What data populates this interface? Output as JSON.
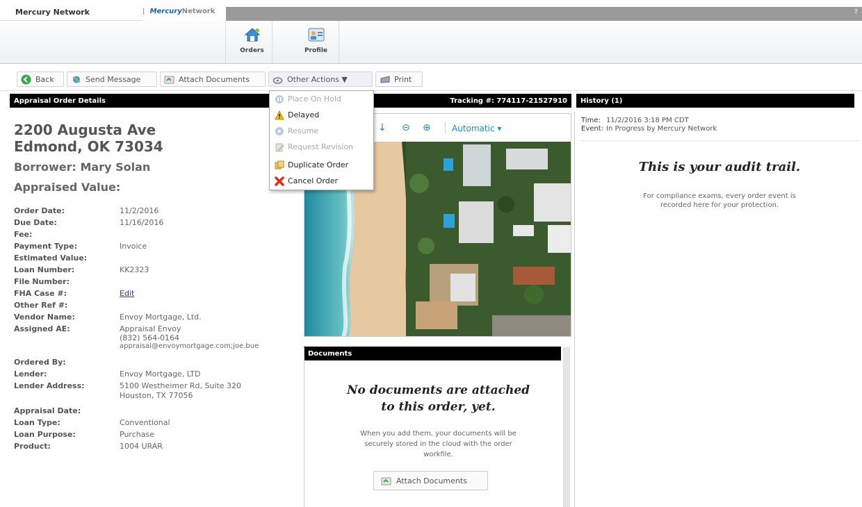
{
  "topbar": {
    "brand": "Mercury Network",
    "tab_sep": "|",
    "tab_mercury": "Mercury",
    "tab_network": "Network"
  },
  "ribbon": {
    "orders_label": "Orders",
    "profile_label": "Profile"
  },
  "toolbar": {
    "back": "Back",
    "send_message": "Send Message",
    "attach_documents": "Attach Documents",
    "other_actions": "Other Actions ▼",
    "print": "Print"
  },
  "left_header": "Appraisal Order Details",
  "tracking_header": "Tracking #: 774117-21527910",
  "history_header": "History (1)",
  "documents_header": "Documents",
  "order": {
    "address_line1": "2200 Augusta Ave",
    "address_line2": "Edmond, OK 73034",
    "borrower": "Borrower: Mary Solan",
    "appraised_value": "Appraised Value:"
  },
  "details": [
    {
      "label": "Order Date:",
      "value": "11/2/2016"
    },
    {
      "label": "Due Date:",
      "value": "11/16/2016"
    },
    {
      "label": "Fee:",
      "value": ""
    },
    {
      "label": "Payment Type:",
      "value": "Invoice"
    },
    {
      "label": "Estimated Value:",
      "value": ""
    },
    {
      "label": "Loan Number:",
      "value": "KK2323"
    },
    {
      "label": "File Number:",
      "value": ""
    },
    {
      "label": "FHA Case #:",
      "value": "Edit"
    },
    {
      "label": "Other Ref #:",
      "value": ""
    },
    {
      "label": "Vendor Name:",
      "value": "Envoy Mortgage, Ltd."
    },
    {
      "label": "Assigned AE:",
      "value": "Appraisal Envoy"
    },
    {
      "label": "",
      "value": "(832) 564-0164"
    },
    {
      "label": "",
      "value": "appraisal@envoymortgage.com;joe.bue"
    },
    {
      "label": "Ordered By:",
      "value": ""
    },
    {
      "label": "Lender:",
      "value": "Envoy Mortgage, LTD"
    },
    {
      "label": "Lender Address:",
      "value": "5100 Westheimer Rd, Suite 320"
    },
    {
      "label": "",
      "value": "Houston, TX 77056"
    },
    {
      "label": "Appraisal Date:",
      "value": ""
    },
    {
      "label": "Loan Type:",
      "value": "Conventional"
    },
    {
      "label": "Loan Purpose:",
      "value": "Purchase"
    },
    {
      "label": "Product:",
      "value": "1004 URAR"
    }
  ],
  "map": {
    "mode": "Automatic ▾"
  },
  "documents": {
    "empty_title_1": "No documents are attached",
    "empty_title_2": "to this order, yet.",
    "empty_text_1": "When you add them, your documents will be",
    "empty_text_2": "securely stored in the cloud with the order",
    "empty_text_3": "workfile.",
    "attach_button": "Attach Documents"
  },
  "history": {
    "time_label": "Time:",
    "time_value": "11/2/2016 3:18 PM CDT",
    "event_label": "Event:",
    "event_value": "In Progress by Mercury Network",
    "audit_title": "This is your audit trail.",
    "audit_text_1": "For compliance exams, every order event is",
    "audit_text_2": "recorded here for your protection."
  },
  "dropdown": {
    "items": [
      {
        "label": "Place On Hold",
        "enabled": false
      },
      {
        "label": "Delayed",
        "enabled": true
      },
      {
        "label": "Resume",
        "enabled": false
      },
      {
        "label": "Request Revision",
        "enabled": false
      },
      {
        "label": "Duplicate Order",
        "enabled": true
      },
      {
        "label": "Cancel Order",
        "enabled": true
      }
    ]
  },
  "colors": {
    "header_bg": "#000000",
    "link": "#1a3ec4",
    "map_accent": "#1a8fc2"
  }
}
